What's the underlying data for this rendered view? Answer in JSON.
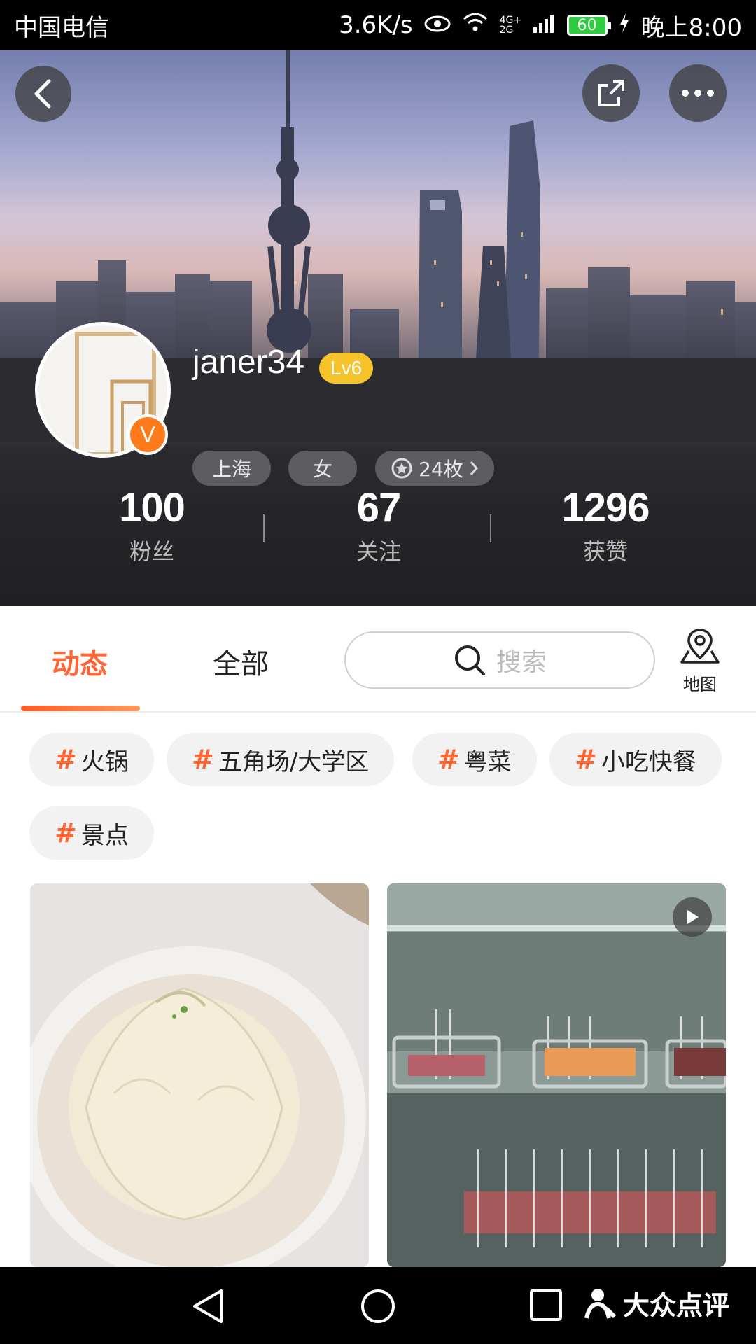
{
  "status_bar": {
    "carrier": "中国电信",
    "speed": "3.6K/s",
    "network": "4G+ 2G",
    "battery": "60",
    "time": "晚上8:00"
  },
  "profile": {
    "username": "janer34",
    "level": "Lv6",
    "verified_badge": "V",
    "city": "上海",
    "gender": "女",
    "medals": "24枚"
  },
  "stats": [
    {
      "value": "100",
      "label": "粉丝"
    },
    {
      "value": "67",
      "label": "关注"
    },
    {
      "value": "1296",
      "label": "获赞"
    }
  ],
  "tabs": [
    {
      "label": "动态",
      "active": true
    },
    {
      "label": "全部",
      "active": false
    }
  ],
  "search": {
    "placeholder": "搜索"
  },
  "map": {
    "label": "地图"
  },
  "tags": [
    {
      "hash": "#",
      "label": "火锅"
    },
    {
      "hash": "#",
      "label": "五角场/大学区"
    },
    {
      "hash": "#",
      "label": "粤菜"
    },
    {
      "hash": "#",
      "label": "小吃快餐"
    },
    {
      "hash": "#",
      "label": "景点"
    }
  ],
  "brand": {
    "name": "大众点评"
  },
  "colors": {
    "accent": "#ff6633",
    "level_badge": "#f6c32a",
    "verified": "#ff7a1a"
  },
  "icons": [
    "back-icon",
    "share-icon",
    "more-icon",
    "medal-icon",
    "chevron-right-icon",
    "search-icon",
    "map-pin-icon",
    "play-icon",
    "nav-back-icon",
    "nav-home-icon",
    "nav-recent-icon"
  ]
}
